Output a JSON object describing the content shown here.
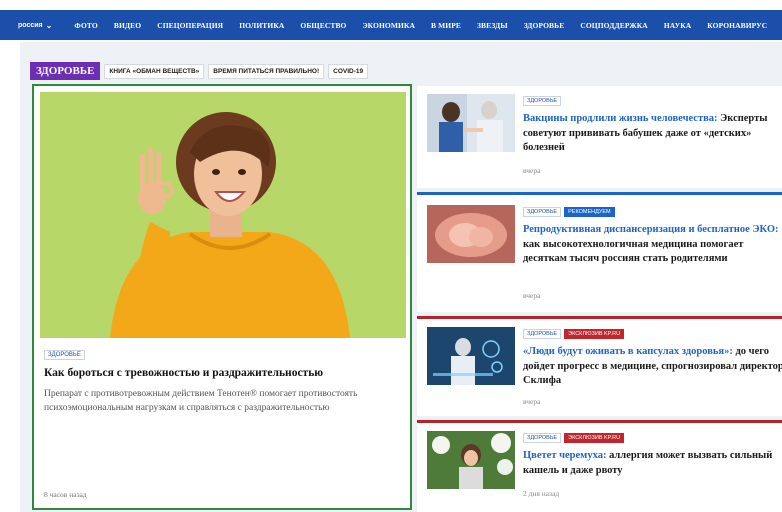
{
  "topnav": {
    "region": "россия",
    "items": [
      "ФОТО",
      "ВИДЕО",
      "СПЕЦОПЕРАЦИЯ",
      "ПОЛИТИКА",
      "ОБЩЕСТВО",
      "ЭКОНОМИКА",
      "В МИРЕ",
      "ЗВЕЗДЫ",
      "ЗДОРОВЬЕ",
      "СОЦПОДДЕРЖКА",
      "НАУКА",
      "КОРОНАВИРУС"
    ]
  },
  "section": {
    "title": "ЗДОРОВЬЕ",
    "tags": [
      "КНИГА «ОБМАН ВЕЩЕСТВ»",
      "ВРЕМЯ ПИТАТЬСЯ ПРАВИЛЬНО!",
      "COVID-19"
    ]
  },
  "featured": {
    "rubric": "ЗДОРОВЬЕ",
    "headline": "Как бороться с тревожностью и раздражительностью",
    "lead": "Препарат с противотревожным действием Тенотен® помогает противостоять психоэмоциональным нагрузкам и справляться с раздражительностью",
    "time": "8 часов назад"
  },
  "cards": [
    {
      "badges": [
        {
          "label": "ЗДОРОВЬЕ",
          "style": "plain"
        }
      ],
      "highlight": "Вакцины продлили жизнь человечества:",
      "rest": " Эксперты советуют прививать бабушек даже от «детских» болезней",
      "date": "вчера"
    },
    {
      "badges": [
        {
          "label": "ЗДОРОВЬЕ",
          "style": "plain"
        },
        {
          "label": "РЕКОМЕНДУЕМ",
          "style": "blue"
        }
      ],
      "highlight": "Репродуктивная диспансеризация и бесплатное ЭКО:",
      "rest": " как высокотехнологичная медицина помогает десяткам тысяч россиян стать родителями",
      "date": "вчера"
    },
    {
      "badges": [
        {
          "label": "ЗДОРОВЬЕ",
          "style": "plain"
        },
        {
          "label": "ЭКСКЛЮЗИВ KP.RU",
          "style": "red"
        }
      ],
      "highlight": "«Люди будут оживать в капсулах здоровья»:",
      "rest": " до чего дойдет прогресс в медицине, спрогнозировал директор Склифа",
      "date": "вчера"
    },
    {
      "badges": [
        {
          "label": "ЗДОРОВЬЕ",
          "style": "plain"
        },
        {
          "label": "ЭКСКЛЮЗИВ KP.RU",
          "style": "red"
        }
      ],
      "highlight": "Цветет черемуха:",
      "rest": " аллергия может вызвать сильный кашель и даже рвоту",
      "date": "2 дня назад"
    }
  ]
}
